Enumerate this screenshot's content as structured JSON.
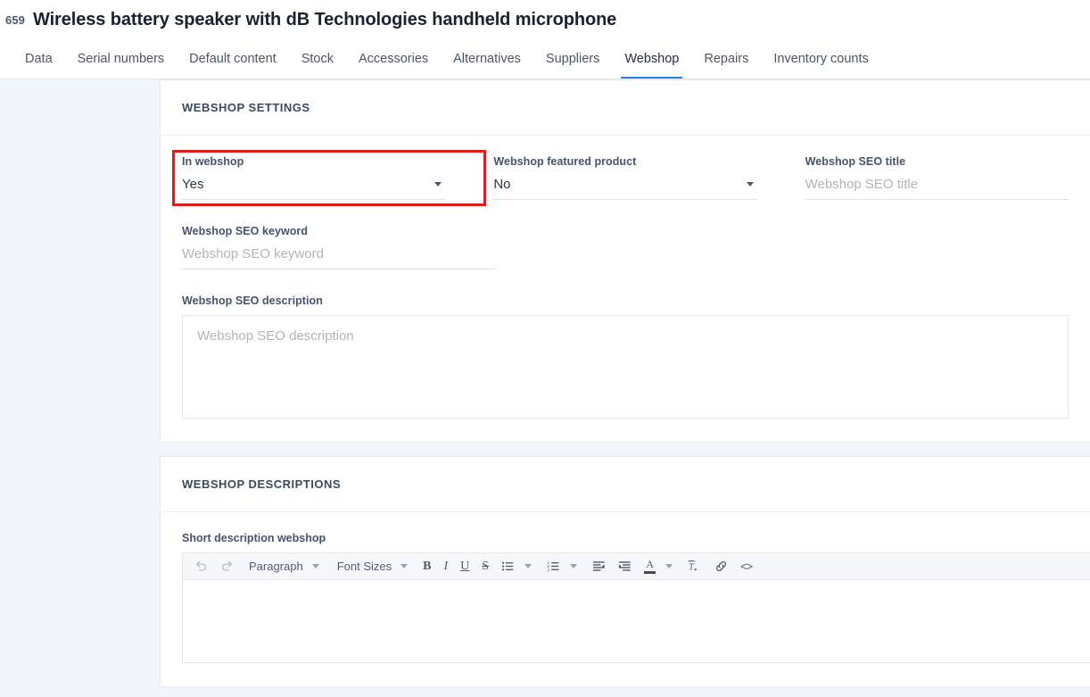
{
  "header": {
    "record_id": "659",
    "title": "Wireless battery speaker with dB Technologies handheld microphone"
  },
  "tabs": [
    {
      "label": "Data",
      "active": false
    },
    {
      "label": "Serial numbers",
      "active": false
    },
    {
      "label": "Default content",
      "active": false
    },
    {
      "label": "Stock",
      "active": false
    },
    {
      "label": "Accessories",
      "active": false
    },
    {
      "label": "Alternatives",
      "active": false
    },
    {
      "label": "Suppliers",
      "active": false
    },
    {
      "label": "Webshop",
      "active": true
    },
    {
      "label": "Repairs",
      "active": false
    },
    {
      "label": "Inventory counts",
      "active": false
    }
  ],
  "webshop_settings": {
    "section_title": "WEBSHOP SETTINGS",
    "in_webshop": {
      "label": "In webshop",
      "value": "Yes",
      "highlighted": true
    },
    "featured_product": {
      "label": "Webshop featured product",
      "value": "No"
    },
    "seo_title": {
      "label": "Webshop SEO title",
      "placeholder": "Webshop SEO title",
      "value": ""
    },
    "seo_keyword": {
      "label": "Webshop SEO keyword",
      "placeholder": "Webshop SEO keyword",
      "value": ""
    },
    "seo_description": {
      "label": "Webshop SEO description",
      "placeholder": "Webshop SEO description",
      "value": ""
    }
  },
  "webshop_descriptions": {
    "section_title": "WEBSHOP DESCRIPTIONS",
    "short_description": {
      "label": "Short description webshop",
      "value": ""
    },
    "toolbar": {
      "undo": "undo-icon",
      "redo": "redo-icon",
      "block_format": "Paragraph",
      "font_size": "Font Sizes",
      "bold": "B",
      "italic": "I",
      "underline": "U",
      "strikethrough": "S",
      "bullet_list": "bullet-list-icon",
      "numbered_list": "numbered-list-icon",
      "outdent": "outdent-icon",
      "indent": "indent-icon",
      "text_color": "A",
      "clear_formatting": "clear-format-icon",
      "link": "link-icon",
      "source_code": "<>"
    }
  },
  "colors": {
    "accent": "#2a7fe0",
    "highlight": "#e01b1b",
    "page_bg": "#f2f5f9",
    "card_bg": "#ffffff",
    "toolbar_bg": "#f5f7fa"
  }
}
